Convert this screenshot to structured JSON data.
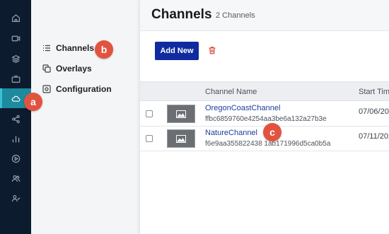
{
  "rail": {
    "items": [
      {
        "icon": "home-icon"
      },
      {
        "icon": "video-icon"
      },
      {
        "icon": "layers-icon"
      },
      {
        "icon": "tv-icon"
      },
      {
        "icon": "cloud-icon",
        "active": true
      },
      {
        "icon": "share-icon"
      },
      {
        "icon": "bar-chart-icon"
      },
      {
        "icon": "play-circle-icon"
      },
      {
        "icon": "users-icon"
      },
      {
        "icon": "user-check-icon"
      }
    ]
  },
  "subnav": {
    "items": [
      {
        "label": "Channels",
        "icon": "list-icon"
      },
      {
        "label": "Overlays",
        "icon": "overlay-icon"
      },
      {
        "label": "Configuration",
        "icon": "settings-icon"
      }
    ]
  },
  "header": {
    "title": "Channels",
    "count": "2 Channels"
  },
  "toolbar": {
    "add_label": "Add New",
    "delete_icon": "trash-icon"
  },
  "table": {
    "columns": [
      "Channel Name",
      "Start Tim"
    ],
    "rows": [
      {
        "name": "OregonCoastChannel",
        "id": "ffbc6859760e4254aa3be6a132a27b3e",
        "date": "07/06/20"
      },
      {
        "name": "NatureChannel",
        "id": "f6e9aa355822438 1ab171996d5ca0b5a",
        "date": "07/11/202"
      }
    ]
  },
  "annotations": {
    "a": "a",
    "b": "b",
    "c": "c"
  },
  "colors": {
    "rail_bg": "#0d1b2e",
    "rail_active": "#1d8a9e",
    "primary_button": "#0f2b9f",
    "link": "#1e3b9a",
    "badge": "#e2533f",
    "trash": "#d9372b"
  }
}
